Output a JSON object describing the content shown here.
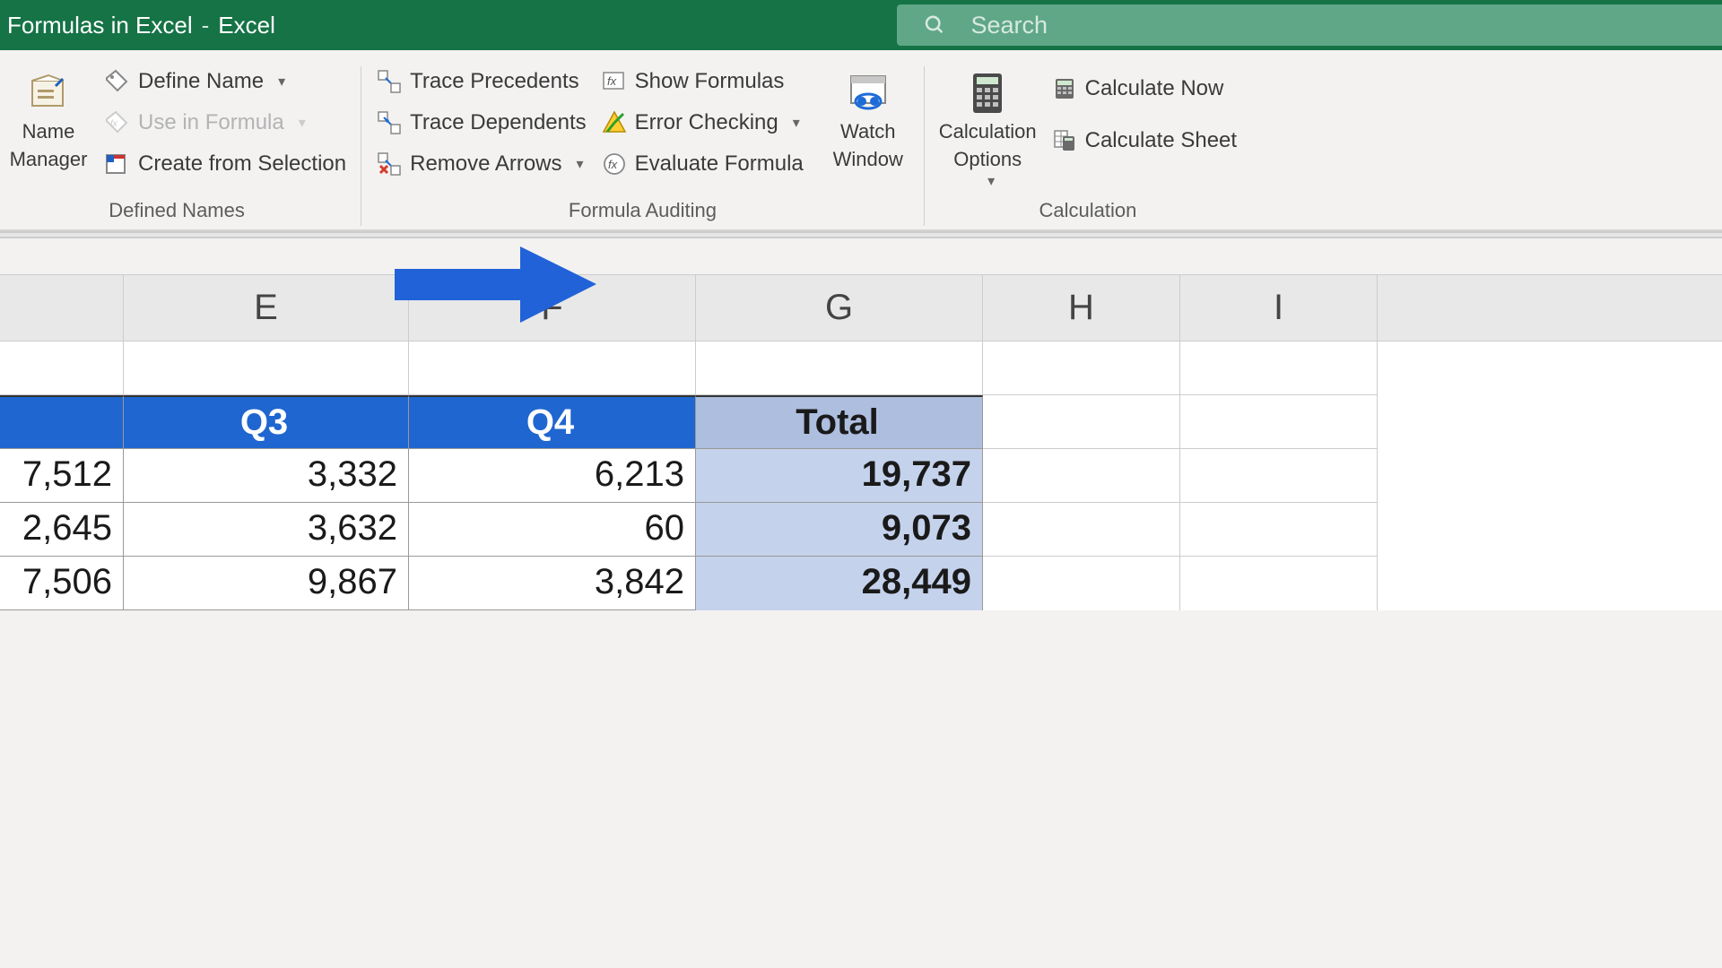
{
  "titlebar": {
    "doc_name": "Formulas in Excel",
    "separator": "-",
    "app_name": "Excel"
  },
  "search": {
    "placeholder": "Search"
  },
  "ribbon": {
    "defined_names": {
      "label": "Defined Names",
      "name_manager": "Name\nManager",
      "define_name": "Define Name",
      "use_in_formula": "Use in Formula",
      "create_from_selection": "Create from Selection"
    },
    "formula_auditing": {
      "label": "Formula Auditing",
      "trace_precedents": "Trace Precedents",
      "trace_dependents": "Trace Dependents",
      "remove_arrows": "Remove Arrows",
      "show_formulas": "Show Formulas",
      "error_checking": "Error Checking",
      "evaluate_formula": "Evaluate Formula",
      "watch_window": "Watch\nWindow"
    },
    "calculation": {
      "label": "Calculation",
      "calculation_options": "Calculation\nOptions",
      "calculate_now": "Calculate Now",
      "calculate_sheet": "Calculate Sheet"
    }
  },
  "columns": [
    "",
    "E",
    "F",
    "G",
    "H",
    "I"
  ],
  "table": {
    "row_header": {
      "d": "",
      "e": "Q3",
      "f": "Q4",
      "g": "Total"
    },
    "rows": [
      {
        "d": "7,512",
        "e": "3,332",
        "f": "6,213",
        "g": "19,737"
      },
      {
        "d": "2,645",
        "e": "3,632",
        "f": "60",
        "g": "9,073"
      },
      {
        "d": "7,506",
        "e": "9,867",
        "f": "3,842",
        "g": "28,449"
      }
    ]
  },
  "chart_data": {
    "type": "table",
    "columns": [
      "Q3",
      "Q4",
      "Total"
    ],
    "rows": [
      {
        "leading": 7512,
        "Q3": 3332,
        "Q4": 6213,
        "Total": 19737
      },
      {
        "leading": 2645,
        "Q3": 3632,
        "Q4": 60,
        "Total": 9073
      },
      {
        "leading": 7506,
        "Q3": 9867,
        "Q4": 3842,
        "Total": 28449
      }
    ]
  }
}
